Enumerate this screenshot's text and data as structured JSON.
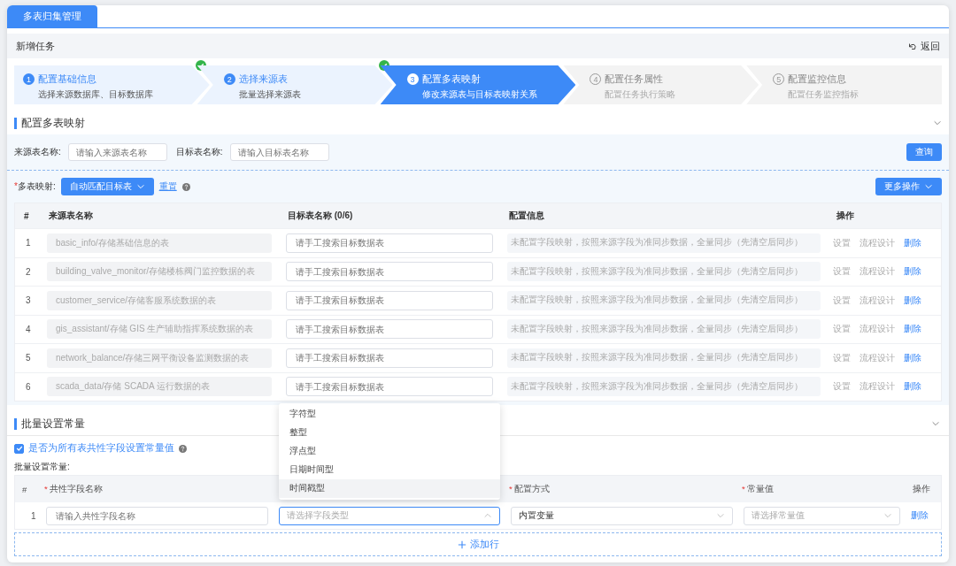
{
  "tab": {
    "label": "多表归集管理",
    "selected": true
  },
  "required_mark": "*",
  "header": {
    "title": "新增任务",
    "back": "返回"
  },
  "steps": [
    {
      "number": "1",
      "title": "配置基础信息",
      "subtitle": "选择来源数据库、目标数据库",
      "completed": true,
      "current": false
    },
    {
      "number": "2",
      "title": "选择来源表",
      "subtitle": "批量选择来源表",
      "completed": true,
      "current": false
    },
    {
      "number": "3",
      "title": "配置多表映射",
      "subtitle": "修改来源表与目标表映射关系",
      "completed": false,
      "current": true
    },
    {
      "number": "4",
      "title": "配置任务属性",
      "subtitle": "配置任务执行策略",
      "completed": false,
      "current": false
    },
    {
      "number": "5",
      "title": "配置监控信息",
      "subtitle": "配置任务监控指标",
      "completed": false,
      "current": false
    }
  ],
  "mapping_section": {
    "title": "配置多表映射",
    "expanded": true,
    "filters": [
      {
        "label": "来源表名称:",
        "placeholder": "请输入来源表名称"
      },
      {
        "label": "目标表名称:",
        "placeholder": "请输入目标表名称"
      }
    ],
    "query_button": "查询",
    "mapping_label": {
      "text": "多表映射:",
      "required": true
    },
    "auto_button": "自动匹配目标表",
    "reset_link": "重置",
    "more_button": "更多操作",
    "table": {
      "columns": [
        "#",
        "来源表名称",
        "目标表名称 (0/6)",
        "配置信息",
        "操作"
      ],
      "rows": [
        {
          "index": "1",
          "source": "basic_info/存储基础信息的表",
          "target_placeholder": "请手工搜索目标数据表",
          "config": "未配置字段映射，按照来源字段为准同步数据，全量同步（先清空后同步）",
          "actions": [
            {
              "label": "设置",
              "disabled": true
            },
            {
              "label": "流程设计",
              "disabled": true
            },
            {
              "label": "删除",
              "disabled": false
            }
          ]
        },
        {
          "index": "2",
          "source": "building_valve_monitor/存储楼栋阀门监控数据的表",
          "target_placeholder": "请手工搜索目标数据表",
          "config": "未配置字段映射，按照来源字段为准同步数据，全量同步（先清空后同步）",
          "actions": [
            {
              "label": "设置",
              "disabled": true
            },
            {
              "label": "流程设计",
              "disabled": true
            },
            {
              "label": "删除",
              "disabled": false
            }
          ]
        },
        {
          "index": "3",
          "source": "customer_service/存储客服系统数据的表",
          "target_placeholder": "请手工搜索目标数据表",
          "config": "未配置字段映射，按照来源字段为准同步数据，全量同步（先清空后同步）",
          "actions": [
            {
              "label": "设置",
              "disabled": true
            },
            {
              "label": "流程设计",
              "disabled": true
            },
            {
              "label": "删除",
              "disabled": false
            }
          ]
        },
        {
          "index": "4",
          "source": "gis_assistant/存储 GIS 生产辅助指挥系统数据的表",
          "target_placeholder": "请手工搜索目标数据表",
          "config": "未配置字段映射，按照来源字段为准同步数据，全量同步（先清空后同步）",
          "actions": [
            {
              "label": "设置",
              "disabled": true
            },
            {
              "label": "流程设计",
              "disabled": true
            },
            {
              "label": "删除",
              "disabled": false
            }
          ]
        },
        {
          "index": "5",
          "source": "network_balance/存储三网平衡设备监测数据的表",
          "target_placeholder": "请手工搜索目标数据表",
          "config": "未配置字段映射，按照来源字段为准同步数据，全量同步（先清空后同步）",
          "actions": [
            {
              "label": "设置",
              "disabled": true
            },
            {
              "label": "流程设计",
              "disabled": true
            },
            {
              "label": "删除",
              "disabled": false
            }
          ]
        },
        {
          "index": "6",
          "source": "scada_data/存储 SCADA 运行数据的表",
          "target_placeholder": "请手工搜索目标数据表",
          "config": "未配置字段映射，按照来源字段为准同步数据，全量同步（先清空后同步）",
          "actions": [
            {
              "label": "设置",
              "disabled": true
            },
            {
              "label": "流程设计",
              "disabled": true
            },
            {
              "label": "删除",
              "disabled": false
            }
          ]
        }
      ]
    }
  },
  "constant_section": {
    "title": "批量设置常量",
    "expanded": true,
    "checkbox": {
      "label": "是否为所有表共性字段设置常量值",
      "checked": true
    },
    "sub_label": "批量设置常量:",
    "table": {
      "columns": [
        {
          "label": "#",
          "required": false
        },
        {
          "label": "共性字段名称",
          "required": true
        },
        null,
        {
          "label": "配置方式",
          "required": true
        },
        {
          "label": "常量值",
          "required": true
        },
        {
          "label": "操作",
          "required": false
        }
      ],
      "rows": [
        {
          "cells": [
            {
              "kind": "index",
              "text": "1"
            },
            {
              "kind": "input",
              "placeholder": "请输入共性字段名称"
            },
            {
              "kind": "select",
              "placeholder": "请选择字段类型",
              "open": true,
              "options": [
                {
                  "label": "字符型",
                  "highlighted": false
                },
                {
                  "label": "整型",
                  "highlighted": false
                },
                {
                  "label": "浮点型",
                  "highlighted": false
                },
                {
                  "label": "日期时间型",
                  "highlighted": false
                },
                {
                  "label": "时间戳型",
                  "highlighted": true
                }
              ]
            },
            {
              "kind": "select",
              "value": "内置变量",
              "open": false
            },
            {
              "kind": "select",
              "placeholder": "请选择常量值",
              "open": false
            },
            {
              "kind": "link",
              "text": "删除"
            }
          ]
        }
      ]
    },
    "add_row": "添加行"
  }
}
